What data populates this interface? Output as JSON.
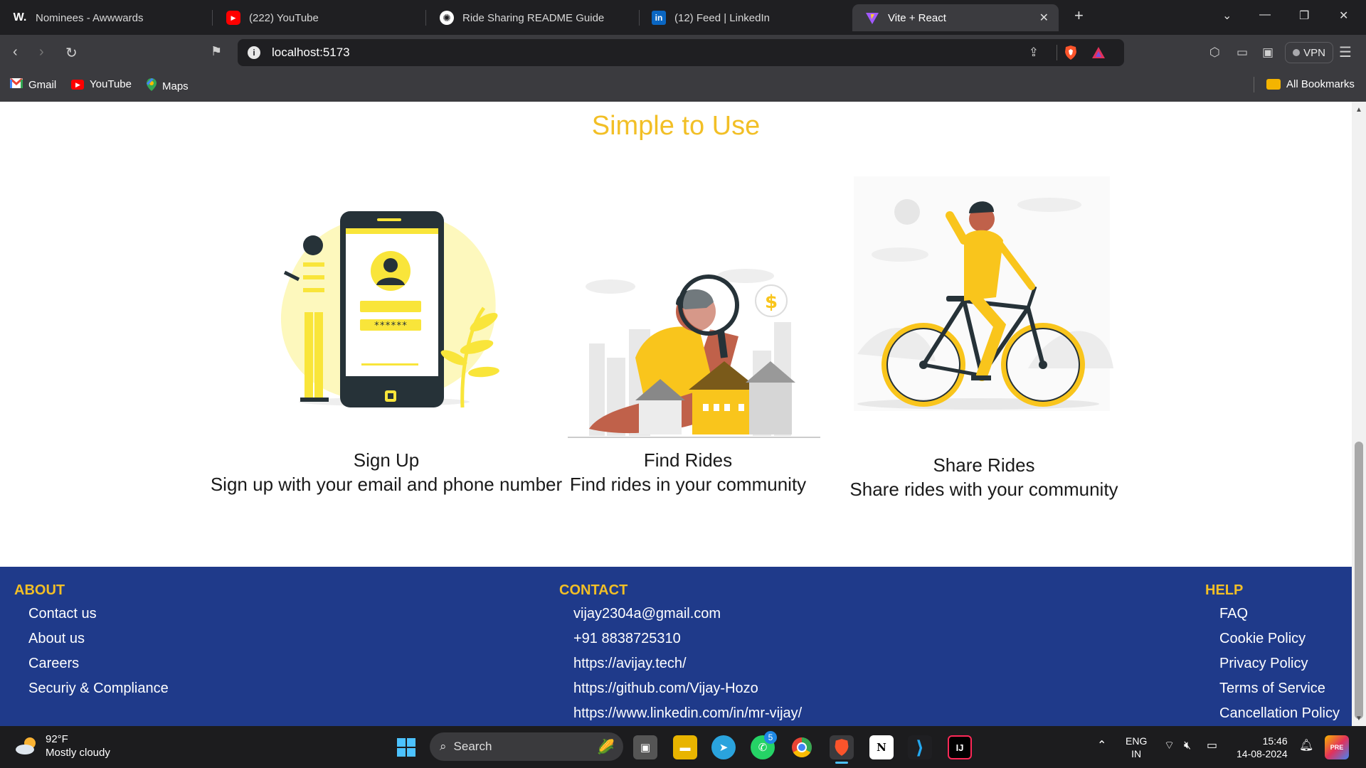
{
  "browser": {
    "tabs": [
      {
        "title": "Nominees - Awwwards",
        "favicon": "W.",
        "color": "#1f1f22"
      },
      {
        "title": "(222) YouTube",
        "favicon": "▶",
        "color": "#ff0000"
      },
      {
        "title": "Ride Sharing README Guide",
        "favicon": "✺",
        "color": "#ffffff"
      },
      {
        "title": "(12) Feed | LinkedIn",
        "favicon": "in",
        "color": "#0a66c2"
      },
      {
        "title": "Vite + React",
        "favicon": "▼",
        "color": "#a259ff",
        "active": true
      }
    ],
    "url": "localhost:5173",
    "vpn_label": "VPN",
    "bookmarks": [
      {
        "label": "Gmail",
        "color": "#ea4335"
      },
      {
        "label": "YouTube",
        "color": "#ff0000"
      },
      {
        "label": "Maps",
        "color": "#34a853"
      }
    ],
    "all_bookmarks": "All Bookmarks"
  },
  "page": {
    "section_title": "Simple to Use",
    "features": [
      {
        "title": "Sign Up",
        "desc": "Sign up with your email and phone number"
      },
      {
        "title": "Find Rides",
        "desc": "Find rides in your community"
      },
      {
        "title": "Share Rides",
        "desc": "Share rides with your community"
      }
    ],
    "signup_password_mask": "******",
    "price_symbol": "$"
  },
  "footer": {
    "about": {
      "heading": "ABOUT",
      "links": [
        "Contact us",
        "About us",
        "Careers",
        "Securiy & Compliance"
      ]
    },
    "contact": {
      "heading": "CONTACT",
      "links": [
        "vijay2304a@gmail.com",
        "+91 8838725310",
        "https://avijay.tech/",
        "https://github.com/Vijay-Hozo",
        "https://www.linkedin.com/in/mr-vijay/"
      ]
    },
    "help": {
      "heading": "HELP",
      "links": [
        "FAQ",
        "Cookie Policy",
        "Privacy Policy",
        "Terms of Service",
        "Cancellation Policy"
      ]
    }
  },
  "taskbar": {
    "weather_temp": "92°F",
    "weather_desc": "Mostly cloudy",
    "search_placeholder": "Search",
    "whatsapp_badge": "5",
    "lang_line1": "ENG",
    "lang_line2": "IN",
    "time": "15:46",
    "date": "14-08-2024"
  },
  "colors": {
    "accent": "#f2bf26",
    "footer_bg": "#1f3a8a"
  }
}
